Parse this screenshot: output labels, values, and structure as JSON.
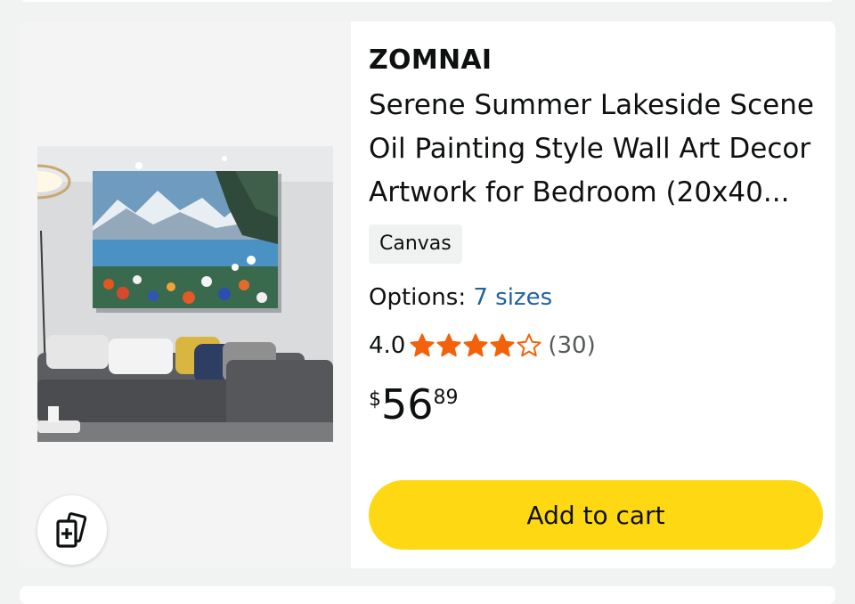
{
  "product": {
    "brand": "ZOMNAI",
    "title": "Serene Summer Lakeside Scene Oil Painting Style Wall Art Decor Artwork for Bedroom (20x40...",
    "format": "Canvas",
    "options_label": "Options:",
    "options_value": "7 sizes",
    "rating": "4.0",
    "rating_value": 4.0,
    "review_count": "(30)",
    "price": {
      "symbol": "$",
      "whole": "56",
      "fraction": "89"
    },
    "add_to_cart_label": "Add to cart"
  },
  "icons": {
    "compare": "compare-cards-plus-icon",
    "star": "star-icon"
  },
  "colors": {
    "star": "#f3620b",
    "link": "#2162a1",
    "cart_button": "#ffd814",
    "chip_bg": "#f0f2f2"
  }
}
